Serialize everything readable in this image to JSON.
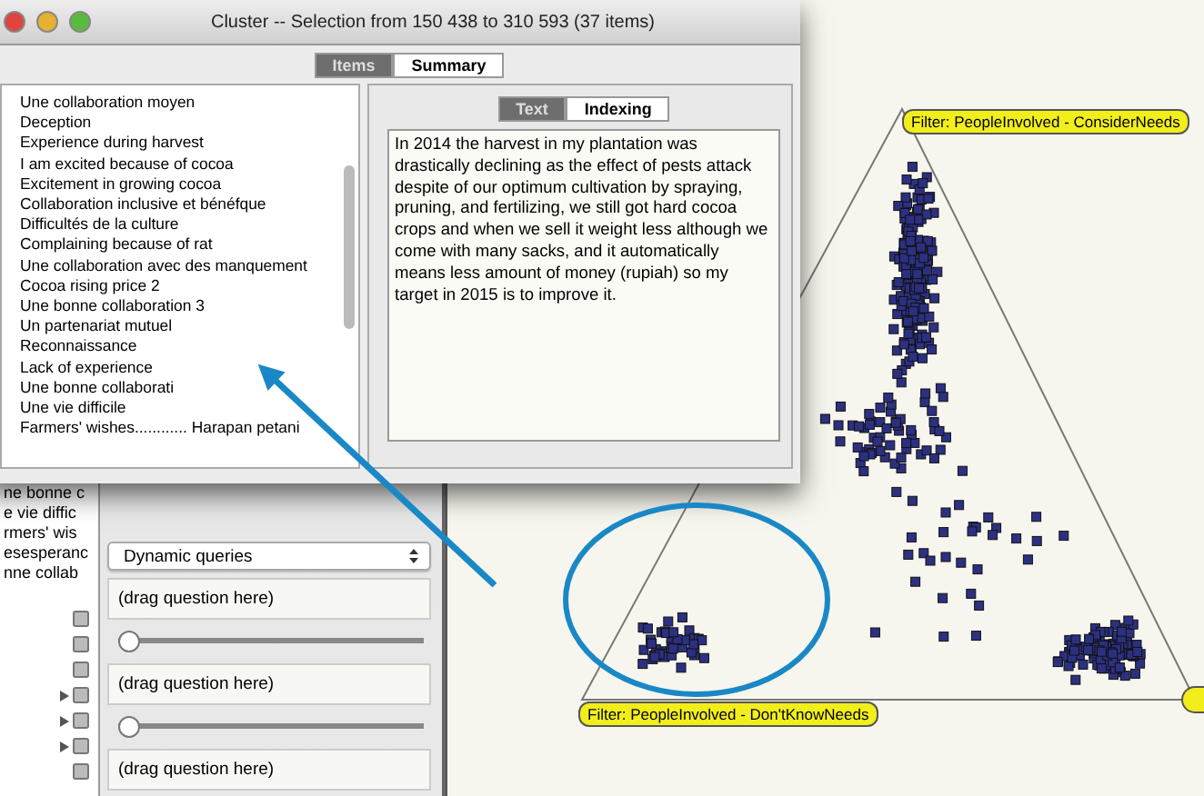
{
  "window": {
    "title": "Cluster -- Selection from 150 438 to 310 593 (37 items)",
    "tabs": [
      {
        "label": "Items",
        "selected": true
      },
      {
        "label": "Summary",
        "selected": false
      }
    ],
    "items": [
      "Une collaboration moyen",
      "Deception",
      "Experience during harvest",
      "I am excited because of cocoa",
      "Excitement in growing cocoa",
      "Collaboration inclusive et bénéfque",
      "Difficultés de la culture",
      "Complaining because of rat",
      "Une collaboration avec des manquement",
      "Cocoa rising price 2",
      "Une bonne collaboration 3",
      "Un partenariat mutuel",
      "Reconnaissance",
      "Lack of experience",
      "Une bonne collaborati",
      "Une vie difficile",
      "Farmers' wishes............ Harapan petani"
    ],
    "detail_tabs": [
      {
        "label": "Text",
        "selected": true
      },
      {
        "label": "Indexing",
        "selected": false
      }
    ],
    "text": "In 2014 the harvest in my plantation was drastically declining as the effect of pests attack despite of our optimum cultivation by spraying, pruning, and fertilizing, we still got hard cocoa crops and when we sell it weight less although we come with many sacks, and it automatically means less amount of money (rupiah) so my target in 2015 is to improve it."
  },
  "background": {
    "list_fragments": [
      "ne bonne c",
      "e vie diffic",
      "rmers' wis",
      "esesperanc",
      "nne collab"
    ],
    "query_mode": "Dynamic queries",
    "queries": [
      {
        "placeholder": "(drag question here)",
        "level": 0
      },
      {
        "placeholder": "(drag question here)",
        "level": 0
      },
      {
        "placeholder": "(drag question here)"
      }
    ],
    "tree": [
      {
        "kind": "leaf"
      },
      {
        "kind": "leaf"
      },
      {
        "kind": "leaf"
      },
      {
        "kind": "folder",
        "expanded": false
      },
      {
        "kind": "folder",
        "expanded": false
      },
      {
        "kind": "folder",
        "expanded": false
      },
      {
        "kind": "leaf"
      }
    ]
  },
  "plot": {
    "labels": [
      {
        "text": "Filter: PeopleInvolved - ConsiderNeeds"
      },
      {
        "text": "Filter: PeopleInvolved - Don'tKnowNeeds"
      }
    ]
  }
}
